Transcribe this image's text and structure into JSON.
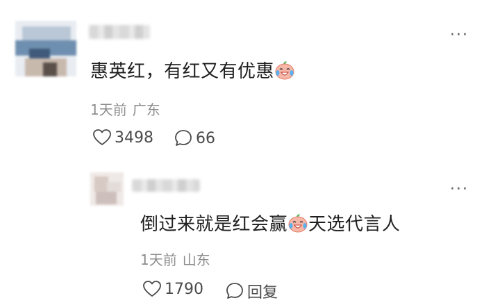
{
  "comment": {
    "text": "惠英红，有红又有优惠",
    "time": "1天前",
    "location": "广东",
    "like_count": "3498",
    "reply_count": "66",
    "emoji": "crying-laughing-face-icon"
  },
  "reply": {
    "text_before_emoji": "倒过来就是红会赢",
    "text_after_emoji": "天选代言人",
    "time": "1天前",
    "location": "山东",
    "like_count": "1790",
    "reply_label": "回复",
    "emoji": "crying-laughing-face-icon"
  },
  "more_label": "···",
  "colors": {
    "text": "#1f1f1f",
    "meta": "#8c8c8c",
    "icon": "#4a4a4a"
  }
}
